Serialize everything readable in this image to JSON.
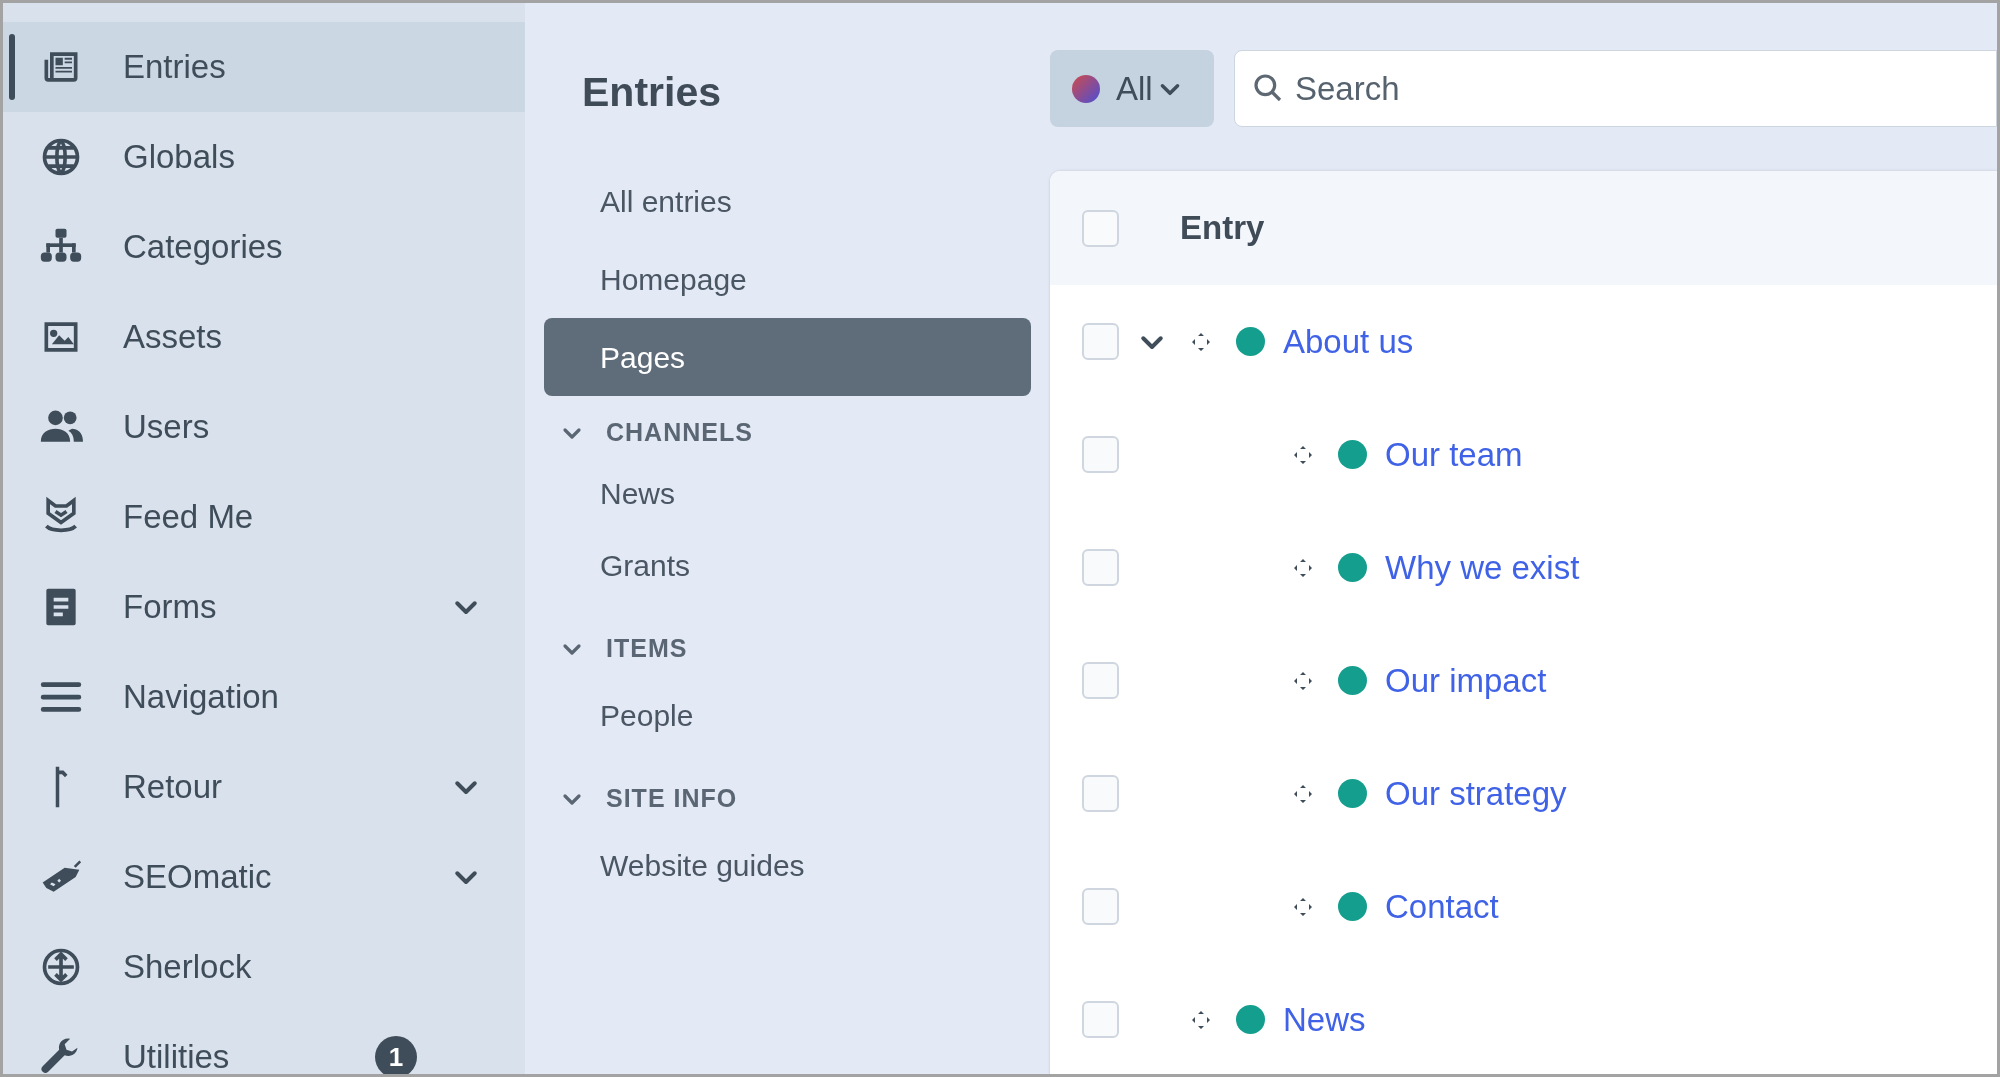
{
  "sidebar": {
    "items": [
      {
        "label": "Entries",
        "selected": true,
        "has_submenu": false
      },
      {
        "label": "Globals",
        "selected": false,
        "has_submenu": false
      },
      {
        "label": "Categories",
        "selected": false,
        "has_submenu": false
      },
      {
        "label": "Assets",
        "selected": false,
        "has_submenu": false
      },
      {
        "label": "Users",
        "selected": false,
        "has_submenu": false
      },
      {
        "label": "Feed Me",
        "selected": false,
        "has_submenu": false
      },
      {
        "label": "Forms",
        "selected": false,
        "has_submenu": true
      },
      {
        "label": "Navigation",
        "selected": false,
        "has_submenu": false
      },
      {
        "label": "Retour",
        "selected": false,
        "has_submenu": true
      },
      {
        "label": "SEOmatic",
        "selected": false,
        "has_submenu": true
      },
      {
        "label": "Sherlock",
        "selected": false,
        "has_submenu": false
      },
      {
        "label": "Utilities",
        "selected": false,
        "has_submenu": false,
        "badge": "1"
      }
    ]
  },
  "sources": {
    "title": "Entries",
    "items": [
      {
        "kind": "item",
        "label": "All entries",
        "selected": false
      },
      {
        "kind": "item",
        "label": "Homepage",
        "selected": false
      },
      {
        "kind": "item",
        "label": "Pages",
        "selected": true
      },
      {
        "kind": "heading",
        "label": "CHANNELS",
        "expanded": true
      },
      {
        "kind": "item",
        "label": "News",
        "selected": false
      },
      {
        "kind": "item",
        "label": "Grants",
        "selected": false
      },
      {
        "kind": "heading",
        "label": "ITEMS",
        "expanded": true
      },
      {
        "kind": "item",
        "label": "People",
        "selected": false
      },
      {
        "kind": "heading",
        "label": "SITE INFO",
        "expanded": true
      },
      {
        "kind": "item",
        "label": "Website guides",
        "selected": false
      }
    ]
  },
  "toolbar": {
    "site_menu": {
      "label": "All"
    },
    "search": {
      "placeholder": "Search"
    }
  },
  "table": {
    "columns": [
      "Entry"
    ],
    "all_checked": false,
    "rows": [
      {
        "title": "About us",
        "color": "#149e8d",
        "checked": false,
        "expanded": true,
        "children": [
          {
            "title": "Our team",
            "color": "#149e8d",
            "checked": false
          },
          {
            "title": "Why we exist",
            "color": "#149e8d",
            "checked": false
          },
          {
            "title": "Our impact",
            "color": "#149e8d",
            "checked": false
          },
          {
            "title": "Our strategy",
            "color": "#149e8d",
            "checked": false
          },
          {
            "title": "Contact",
            "color": "#149e8d",
            "checked": false
          }
        ]
      },
      {
        "title": "News",
        "color": "#149e8d",
        "checked": false
      }
    ]
  }
}
